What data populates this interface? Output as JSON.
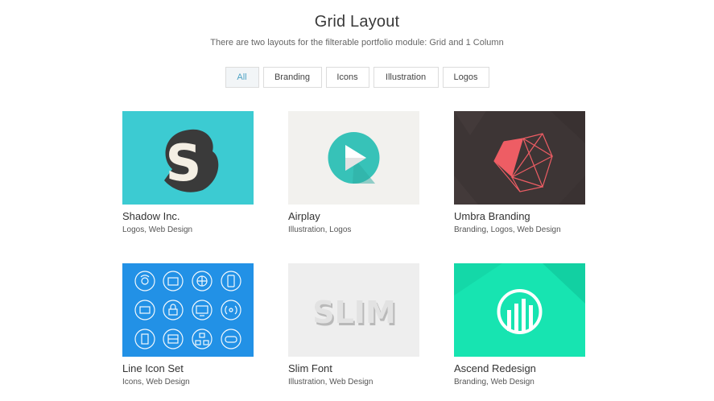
{
  "header": {
    "title": "Grid Layout",
    "subtitle": "There are two layouts for the filterable portfolio module: Grid and 1 Column"
  },
  "filters": [
    "All",
    "Branding",
    "Icons",
    "Illustration",
    "Logos"
  ],
  "active_filter": "All",
  "colors": {
    "accent": "#4fa3c4",
    "shadow_bg": "#3ccbd2",
    "airplay_bg": "#f2f1ee",
    "airplay_circle": "#37c2b8",
    "umbra_bg": "#3d3535",
    "umbra_shape": "#ee5d64",
    "icons_bg": "#2291e6",
    "slim_bg": "#eeeeee",
    "ascend_bg": "#17e4b1"
  },
  "items": [
    {
      "title": "Shadow Inc.",
      "tags": "Logos, Web Design",
      "thumb": "shadow-s-logo"
    },
    {
      "title": "Airplay",
      "tags": "Illustration, Logos",
      "thumb": "play-icon"
    },
    {
      "title": "Umbra Branding",
      "tags": "Branding, Logos, Web Design",
      "thumb": "polygon-graphic"
    },
    {
      "title": "Line Icon Set",
      "tags": "Icons, Web Design",
      "thumb": "icon-grid"
    },
    {
      "title": "Slim Font",
      "tags": "Illustration, Web Design",
      "thumb": "slim-lettering",
      "art_text": "SLIM"
    },
    {
      "title": "Ascend Redesign",
      "tags": "Branding, Web Design",
      "thumb": "ascend-logo"
    }
  ]
}
